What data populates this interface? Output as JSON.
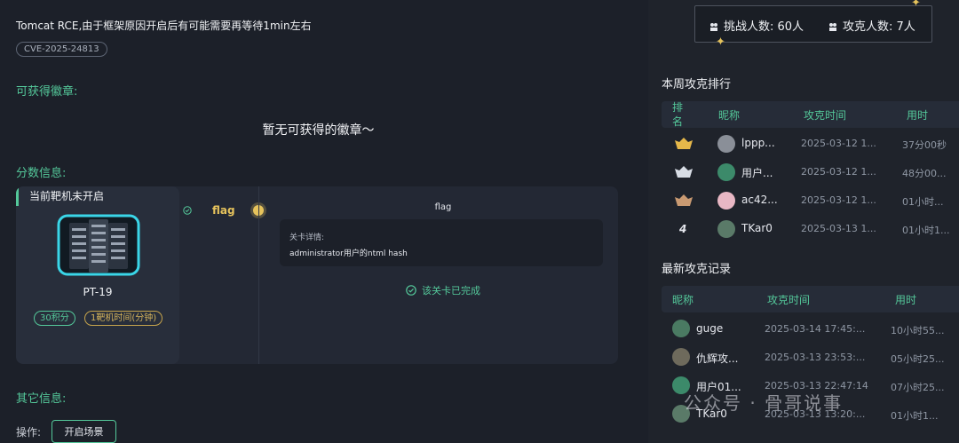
{
  "title": "Tomcat RCE,由于框架原因开启后有可能需要再等待1min左右",
  "cve_tag": "CVE-2025-24813",
  "sections": {
    "badges": "可获得徽章:",
    "score_info": "分数信息:",
    "other_info": "其它信息:"
  },
  "no_badge_text": "暂无可获得的徽章～",
  "target": {
    "status": "当前靶机未开启",
    "name": "PT-19",
    "score_tag": "30积分",
    "time_tag": "1靶机时间(分钟)"
  },
  "flag": {
    "label": "flag",
    "detail_title": "flag",
    "detail_label": "关卡详情:",
    "detail_text": "administrator用户的ntml hash",
    "completed_text": "该关卡已完成"
  },
  "operation": {
    "label": "操作:",
    "start_button": "开启场景"
  },
  "stats": {
    "challengers": "挑战人数: 60人",
    "solvers": "攻克人数: 7人"
  },
  "weekly_rank": {
    "heading": "本周攻克排行",
    "headers": [
      "排名",
      "昵称",
      "攻克时间",
      "用时"
    ],
    "rows": [
      {
        "rank": "1",
        "medal": "gold-medal-icon",
        "nickname": "lppp...",
        "time": "2025-03-12 1...",
        "duration": "37分00秒"
      },
      {
        "rank": "2",
        "medal": "silver-medal-icon",
        "nickname": "用户...",
        "time": "2025-03-12 1...",
        "duration": "48分00..."
      },
      {
        "rank": "3",
        "medal": "bronze-medal-icon",
        "nickname": "ac42...",
        "time": "2025-03-12 1...",
        "duration": "01小时..."
      },
      {
        "rank": "4",
        "medal": "",
        "nickname": "TKar0",
        "time": "2025-03-13 1...",
        "duration": "01小时1..."
      }
    ]
  },
  "recent": {
    "heading": "最新攻克记录",
    "headers": [
      "昵称",
      "攻克时间",
      "用时"
    ],
    "rows": [
      {
        "nickname": "guge",
        "time": "2025-03-14 17:45:...",
        "duration": "10小时55..."
      },
      {
        "nickname": "仇辉攻...",
        "time": "2025-03-13 23:53:...",
        "duration": "05小时25..."
      },
      {
        "nickname": "用户01...",
        "time": "2025-03-13 22:47:14",
        "duration": "07小时25..."
      },
      {
        "nickname": "TKar0",
        "time": "2025-03-13 13:20:...",
        "duration": "01小时1..."
      }
    ]
  },
  "watermark": "公众号 · 骨哥说事",
  "colors": {
    "accent_green": "#54c89a",
    "accent_gold": "#e6c35c",
    "background": "#1c2029"
  }
}
